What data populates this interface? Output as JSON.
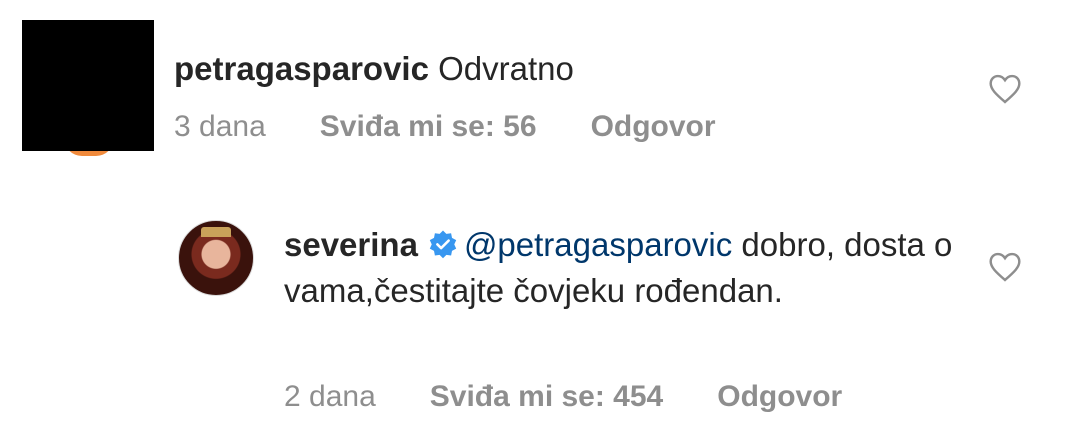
{
  "comments": [
    {
      "username": "petragasparovic",
      "text": "Odvratno",
      "time": "3 dana",
      "likes": "Sviđa mi se: 56",
      "reply": "Odgovor"
    },
    {
      "username": "severina",
      "verified": true,
      "mention": "@petragasparovic",
      "text": "dobro, dosta o vama,čestitajte čovjeku rođendan.",
      "time": "2 dana",
      "likes": "Sviđa mi se: 454",
      "reply": "Odgovor"
    }
  ],
  "colors": {
    "mention": "#00376b",
    "meta": "#8e8e8e",
    "verified": "#3897f0"
  },
  "icons": {
    "like": "heart-outline-icon",
    "verified": "verified-badge-icon"
  }
}
